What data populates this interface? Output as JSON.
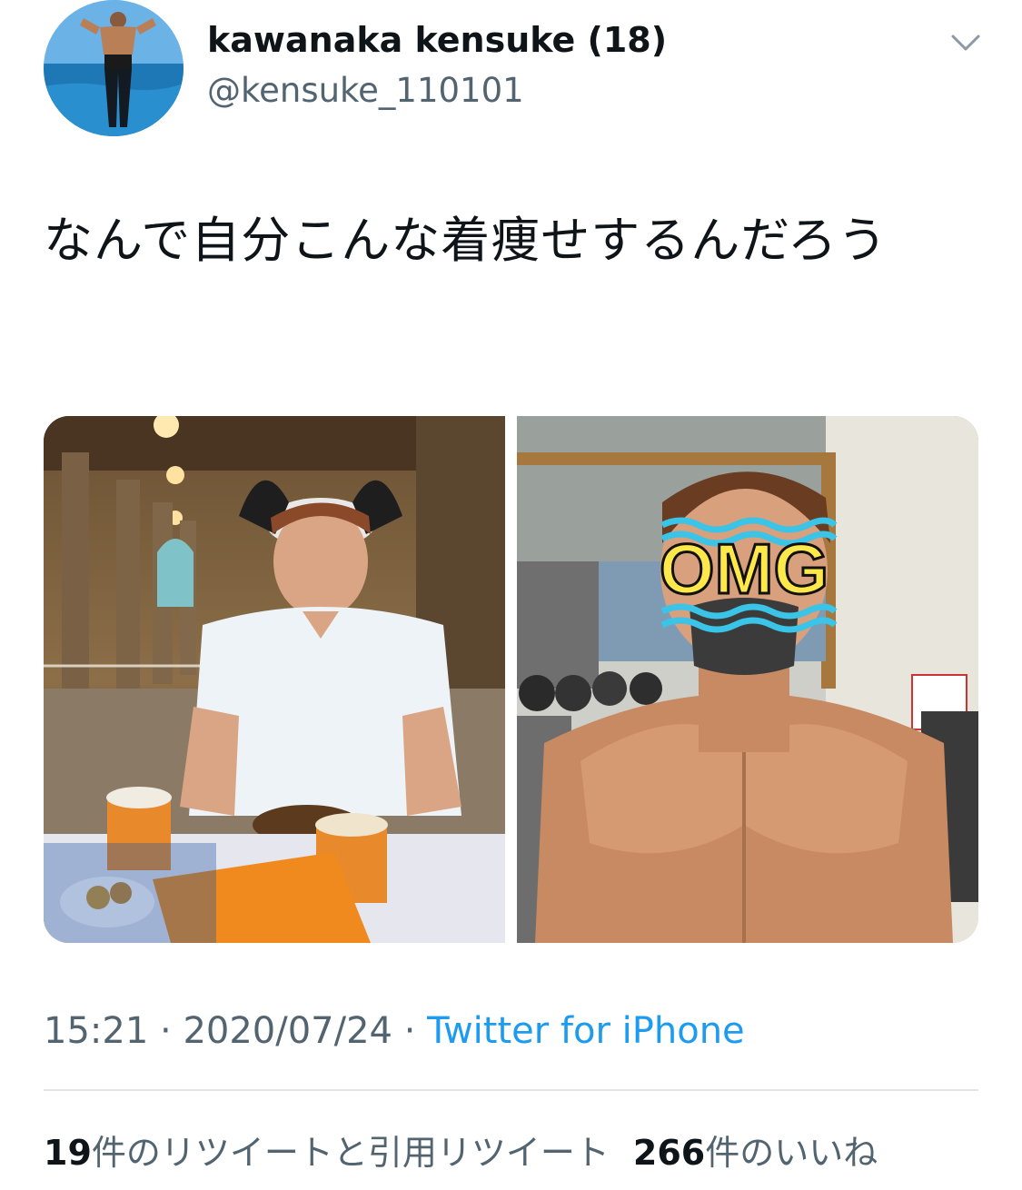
{
  "author": {
    "display_name": "kawanaka kensuke (18)",
    "handle": "@kensuke_110101"
  },
  "tweet": {
    "text": "なんで自分こんな着痩せするんだろう",
    "overlay_text": "OMG"
  },
  "meta": {
    "time": "15:21",
    "separator1": " · ",
    "date": "2020/07/24",
    "separator2": " · ",
    "source": "Twitter for iPhone"
  },
  "stats": {
    "retweets_count": "19",
    "retweets_label": "件のリツイートと引用リツイート",
    "likes_count": "266",
    "likes_label": "件のいいね"
  },
  "icons": {
    "menu": "chevron-down-icon"
  }
}
